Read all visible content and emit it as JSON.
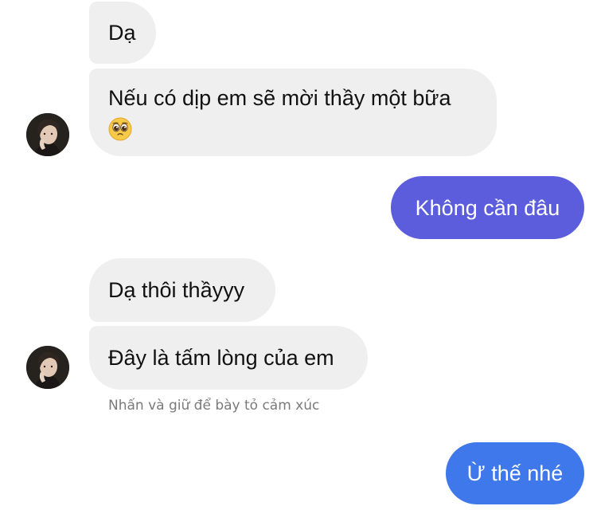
{
  "messages": {
    "m1": "Dạ",
    "m2_line1": "Nếu có dịp em sẽ mời thầy một bữa",
    "m2_emoji": "pleading-face-emoji",
    "m3": "Không cần đâu",
    "m4": "Dạ thôi thầyyy",
    "m5": "Đây là tấm lòng của em",
    "m6": "Ừ thế nhé"
  },
  "hint": "Nhấn và giữ để bày tỏ cảm xúc",
  "colors": {
    "incoming_bubble": "#efefef",
    "outgoing_bubble_1": "#5b5ddc",
    "outgoing_bubble_2": "#3f78ea",
    "text_dark": "#111111",
    "text_light": "#ffffff",
    "hint_text": "#7a7a7a"
  },
  "icons": {
    "avatar": "contact-avatar-photo"
  }
}
